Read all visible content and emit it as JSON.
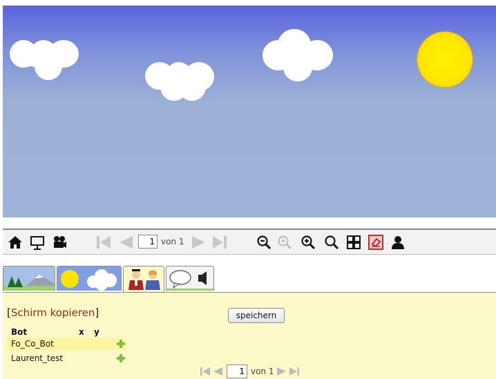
{
  "toolbar": {
    "icons": [
      "home-icon",
      "presentation-icon",
      "camera-icon",
      "first-page-icon",
      "prev-page-icon",
      "next-page-icon",
      "last-page-icon",
      "zoom-out-icon",
      "zoom-reset-icon",
      "zoom-in-icon",
      "zoom-fit-icon",
      "grid-icon",
      "eraser-icon",
      "user-icon"
    ],
    "page_value": "1",
    "page_of_label": "von 1"
  },
  "tabs": [
    {
      "name": "landscape",
      "icon": "mountain-icon"
    },
    {
      "name": "sky",
      "icon": "sun-cloud-icon"
    },
    {
      "name": "characters",
      "icon": "people-icon",
      "active": true
    },
    {
      "name": "dialog",
      "icon": "speech-bubble-icon"
    }
  ],
  "panel": {
    "title_open": "[",
    "title_link": "Schirm kopieren",
    "title_close": "]",
    "save_label": "speichern",
    "columns": {
      "bot": "Bot",
      "x": "x",
      "y": "y"
    },
    "bots": [
      {
        "name": "Fo_Co_Bot",
        "selected": true
      },
      {
        "name": "Laurent_test",
        "selected": false
      }
    ],
    "page_value": "1",
    "page_of_label": "von 1"
  },
  "colors": {
    "sky_top": "#5b63df",
    "sky_bottom": "#9fb3da",
    "sun": "#ffe800",
    "panel_bg": "#fcf9c8",
    "link": "#9b2a1a",
    "add_icon": "#7fbf3f",
    "selected_row": "#fdf3a0"
  }
}
